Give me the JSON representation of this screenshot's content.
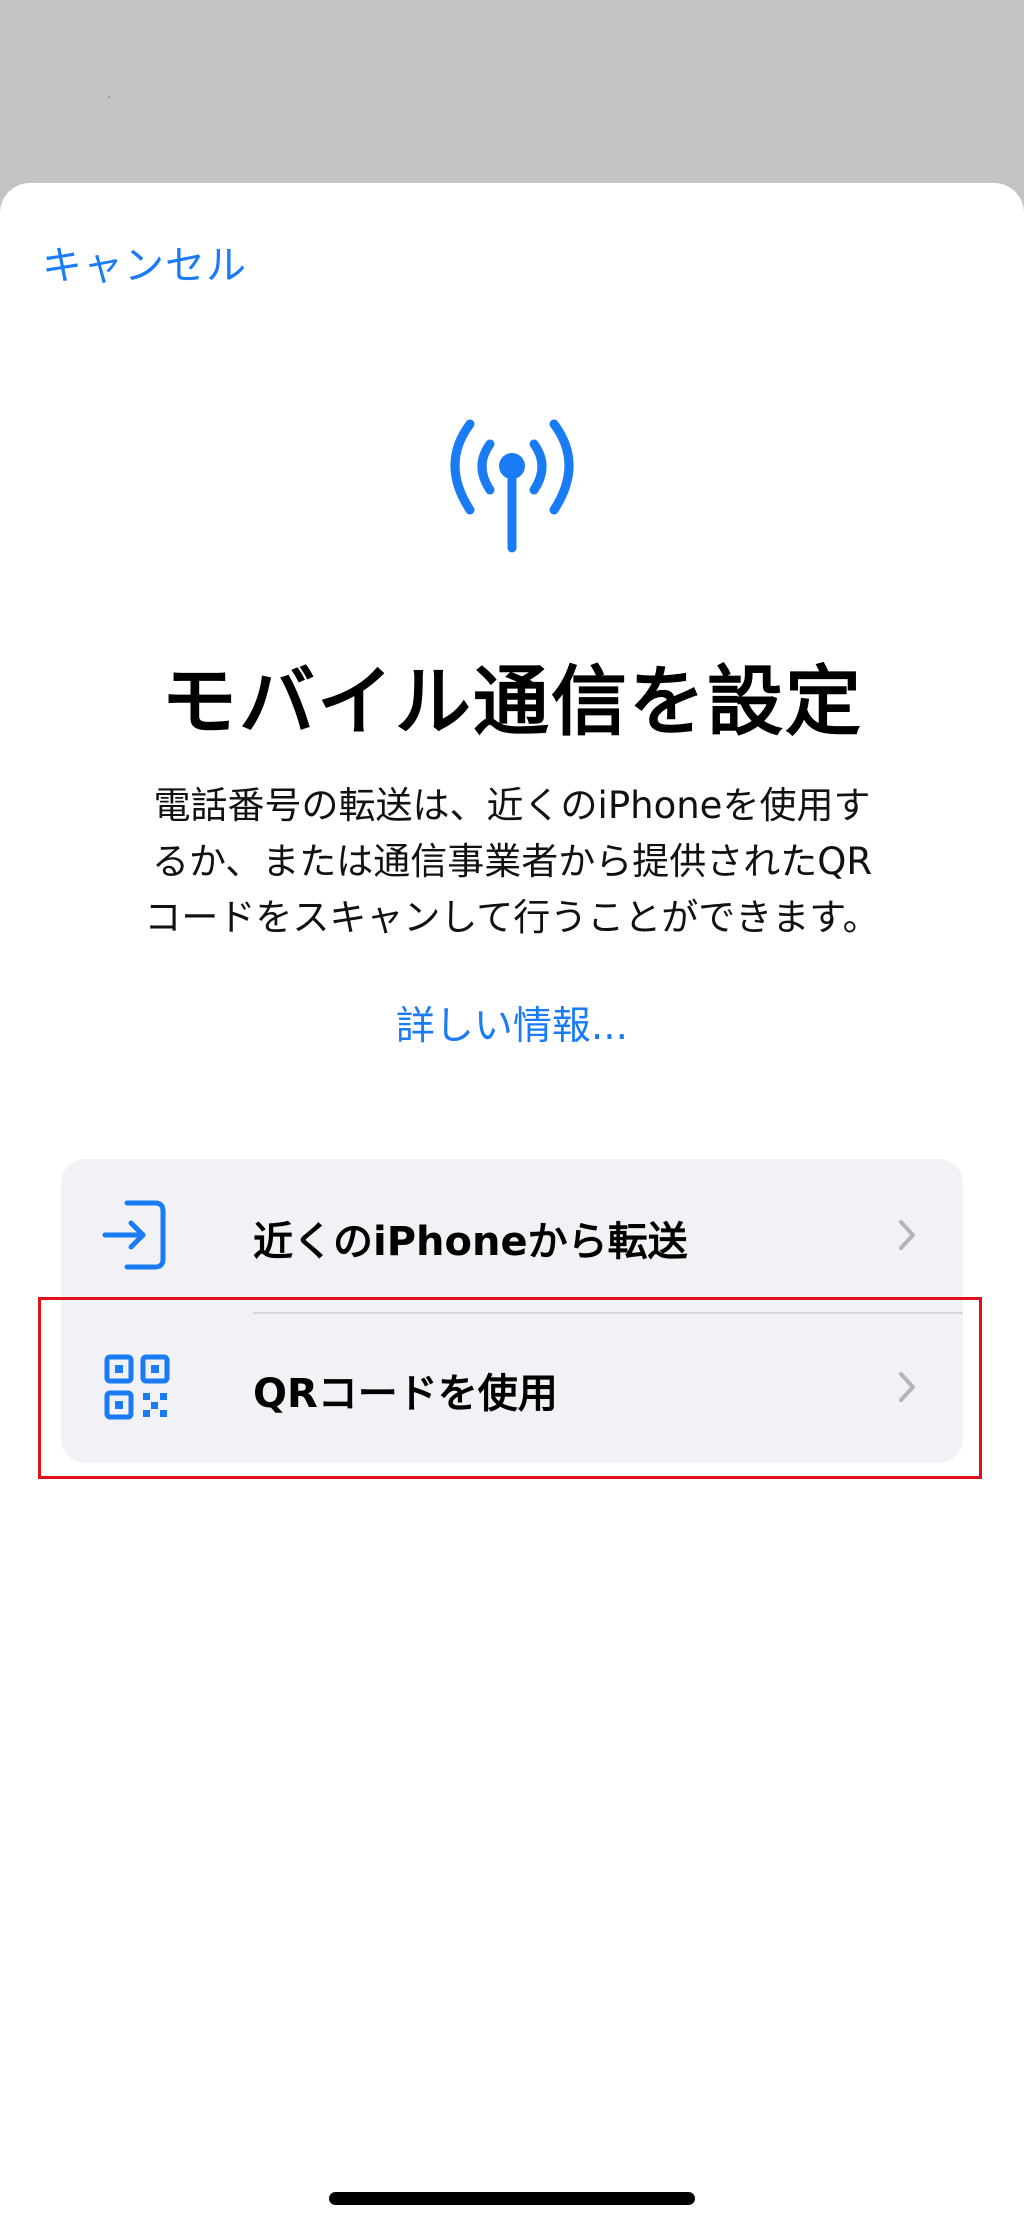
{
  "header": {
    "cancel_label": "キャンセル"
  },
  "hero": {
    "icon": "antenna-radiowaves-icon",
    "title": "モバイル通信を設定",
    "description_lines": [
      "電話番号の転送は、近くのiPhoneを使用す",
      "るか、または通信事業者から提供されたQR",
      "コードをスキャンして行うことができます。"
    ],
    "more_link": "詳しい情報..."
  },
  "options": [
    {
      "icon": "transfer-arrow-icon",
      "label": "近くのiPhoneから転送"
    },
    {
      "icon": "qr-code-icon",
      "label": "QRコードを使用"
    }
  ],
  "colors": {
    "accent": "#1a7cf5",
    "highlight": "#e3101c",
    "group_background": "#f1f1f6"
  }
}
